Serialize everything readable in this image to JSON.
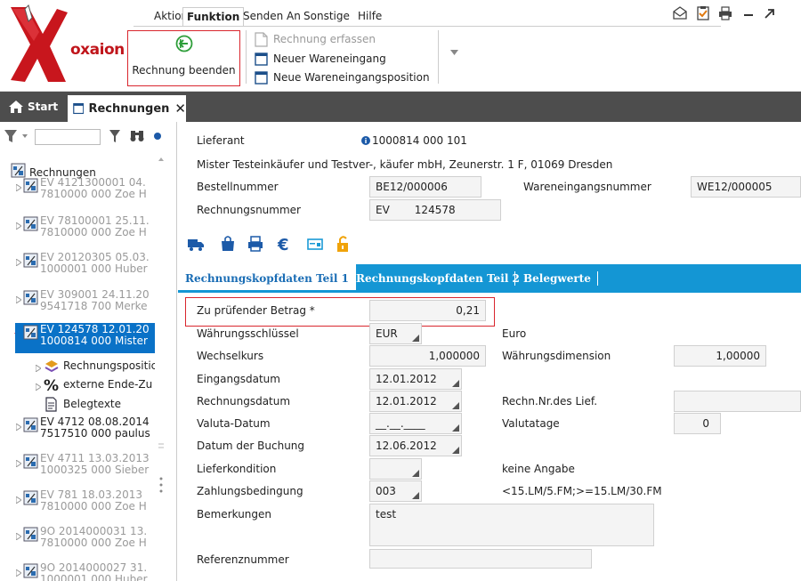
{
  "logo": {
    "word": "oxaion"
  },
  "menu": {
    "items": [
      "Aktion",
      "Funktion",
      "Senden An",
      "Sonstige",
      "Hilfe"
    ],
    "active": "Funktion"
  },
  "ribbon": {
    "finish_label": "Rechnung beenden",
    "commands": [
      "Rechnung erfassen",
      "Neuer Wareneingang",
      "Neue Wareneingangsposition"
    ]
  },
  "tabs": {
    "start": "Start",
    "rechnungen": "Rechnungen"
  },
  "sidebar": {
    "root": "Rechnungen",
    "items": [
      {
        "line1": "EV 4121300001 04.",
        "line2": "7810000 000 Zoe H"
      },
      {
        "line1": "EV 78100001 25.11.",
        "line2": "7810000 000 Zoe H"
      },
      {
        "line1": "EV 20120305 05.03.",
        "line2": "1000001 000 Huber"
      },
      {
        "line1": "EV 309001 24.11.20",
        "line2": "9541718 700 Merke"
      },
      {
        "line1": "EV 124578 12.01.20",
        "line2": "1000814 000 Mister"
      },
      {
        "line1": "EV 4712 08.08.2014",
        "line2": "7517510 000 paulus"
      },
      {
        "line1": "EV 4711 13.03.2013",
        "line2": "1000325 000 Sieber"
      },
      {
        "line1": "EV 781 18.03.2013",
        "line2": "7810000 000 Zoe H"
      },
      {
        "line1": "9O 2014000031 13.",
        "line2": "7810000 000 Zoe H"
      },
      {
        "line1": "9O 2014000027 31.",
        "line2": "1000001 000 Huber"
      }
    ],
    "children": [
      "Rechnungspositic",
      "externe Ende-Zu",
      "Belegtexte"
    ]
  },
  "header": {
    "lieferant_label": "Lieferant",
    "lieferant_value": "1000814 000 101",
    "address": "Mister Testeinkäufer und Testver-, käufer mbH, Zeunerstr. 1 F, 01069 Dresden",
    "bestell_label": "Bestellnummer",
    "bestell_value": "BE12/000006",
    "we_label": "Wareneingangsnummer",
    "we_value": "WE12/000005",
    "rech_label": "Rechnungsnummer",
    "rech_prefix": "EV",
    "rech_value": "124578"
  },
  "subtabs": [
    "Rechnungskopfdaten Teil 1",
    "Rechnungskopfdaten Teil 2",
    "Belegwerte"
  ],
  "form": {
    "betrag_label": "Zu prüfender Betrag *",
    "betrag_value": "0,21",
    "waehrung_label": "Währungsschlüssel",
    "waehrung_value": "EUR",
    "waehrung_text": "Euro",
    "wechselkurs_label": "Wechselkurs",
    "wechselkurs_value": "1,000000",
    "wdim_label": "Währungsdimension",
    "wdim_value": "1,00000",
    "eingang_label": "Eingangsdatum",
    "eingang_value": "12.01.2012",
    "rechdatum_label": "Rechnungsdatum",
    "rechdatum_value": "12.01.2012",
    "rechnr_lief_label": "Rechn.Nr.des Lief.",
    "valuta_label": "Valuta-Datum",
    "valuta_value": "__.__.____",
    "valutatage_label": "Valutatage",
    "valutatage_value": "0",
    "buchung_label": "Datum der Buchung",
    "buchung_value": "12.06.2012",
    "liefer_label": "Lieferkondition",
    "liefer_text": "keine Angabe",
    "zahlung_label": "Zahlungsbedingung",
    "zahlung_value": "003",
    "zahlung_text": "<15.LM/5.FM;>=15.LM/30.FM",
    "bemerk_label": "Bemerkungen",
    "bemerk_value": "test",
    "referenz_label": "Referenznummer"
  },
  "colors": {
    "accent": "#1496d4",
    "selection": "#0a72c7",
    "brand": "#c0151b",
    "highlight": "#d9262e"
  }
}
